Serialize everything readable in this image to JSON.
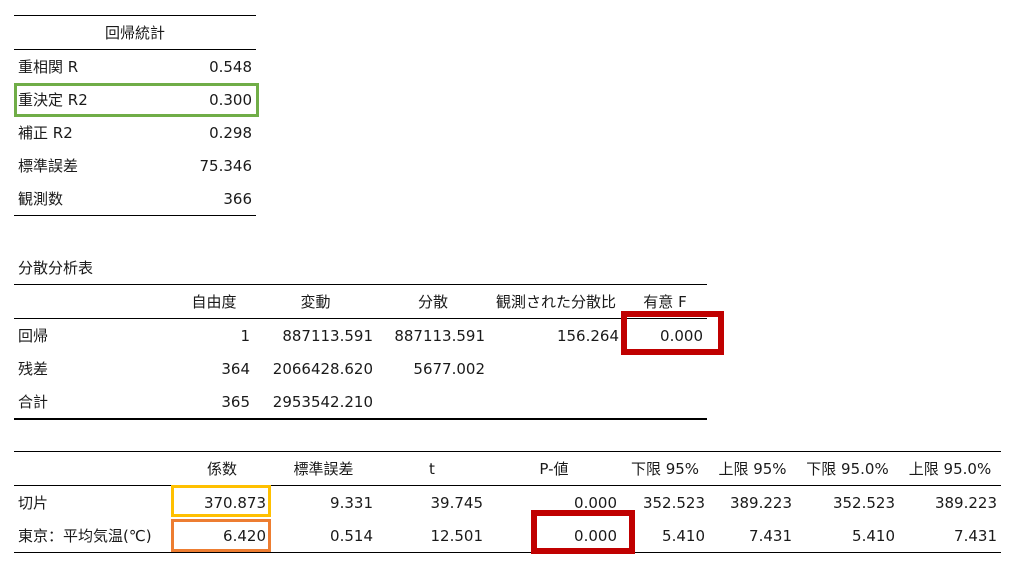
{
  "regression_stats": {
    "title": "回帰統計",
    "rows": [
      {
        "label": "重相関 R",
        "value": "0.548"
      },
      {
        "label": "重決定 R2",
        "value": "0.300"
      },
      {
        "label": "補正 R2",
        "value": "0.298"
      },
      {
        "label": "標準誤差",
        "value": "75.346"
      },
      {
        "label": "観測数",
        "value": "366"
      }
    ]
  },
  "anova": {
    "title": "分散分析表",
    "headers": [
      "",
      "自由度",
      "変動",
      "分散",
      "観測された分散比",
      "有意 F"
    ],
    "rows": [
      [
        "回帰",
        "1",
        "887113.591",
        "887113.591",
        "156.264",
        "0.000"
      ],
      [
        "残差",
        "364",
        "2066428.620",
        "5677.002",
        "",
        ""
      ],
      [
        "合計",
        "365",
        "2953542.210",
        "",
        "",
        ""
      ]
    ]
  },
  "coefficients": {
    "headers": [
      "",
      "係数",
      "標準誤差",
      "t",
      "P-値",
      "下限 95%",
      "上限 95%",
      "下限 95.0%",
      "上限 95.0%"
    ],
    "rows": [
      [
        "切片",
        "370.873",
        "9.331",
        "39.745",
        "0.000",
        "352.523",
        "389.223",
        "352.523",
        "389.223"
      ],
      [
        "東京：平均気温(℃)",
        "6.420",
        "0.514",
        "12.501",
        "0.000",
        "5.410",
        "7.431",
        "5.410",
        "7.431"
      ]
    ]
  },
  "highlight_colors": {
    "green": "#70ad47",
    "red": "#c00000",
    "yellow": "#ffc000",
    "orange": "#ed7d31"
  }
}
